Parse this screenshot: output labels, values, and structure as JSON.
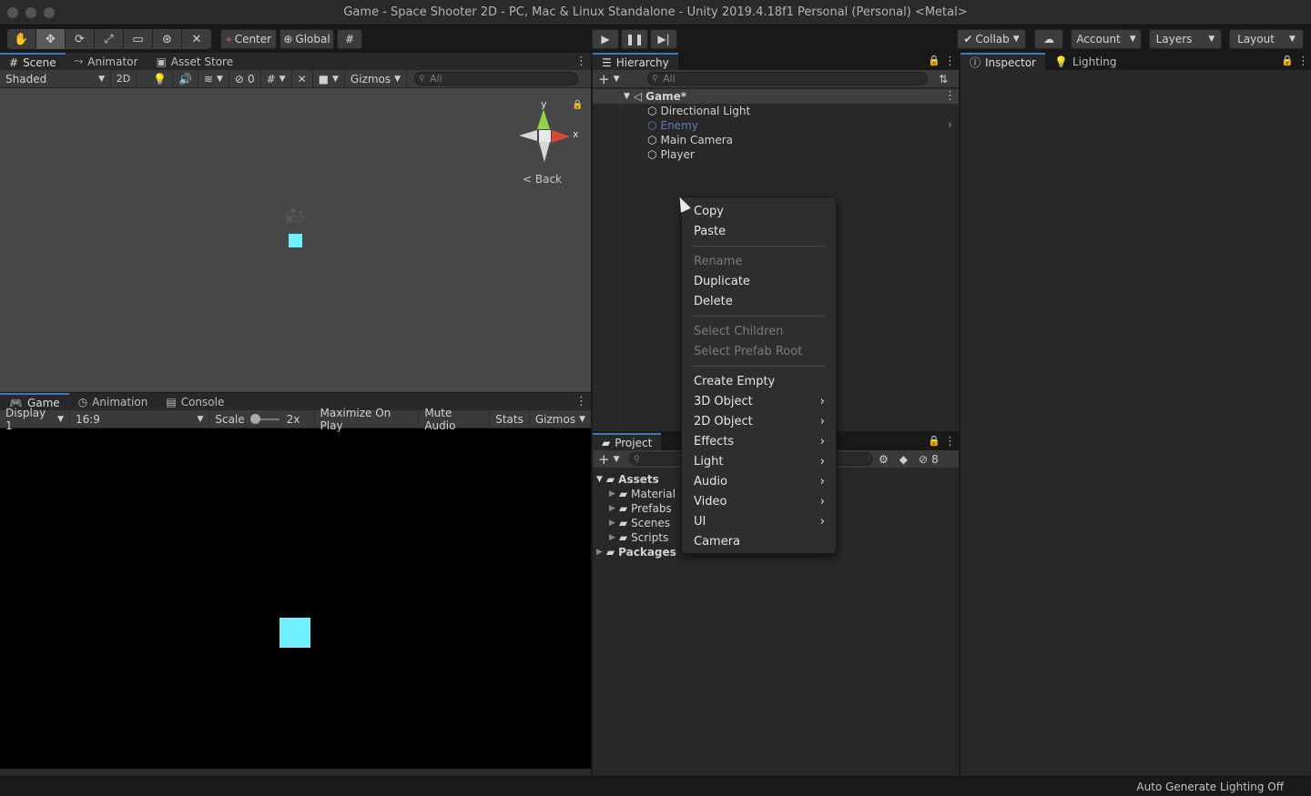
{
  "window": {
    "title": "Game - Space Shooter 2D - PC, Mac & Linux Standalone - Unity 2019.4.18f1 Personal (Personal) <Metal>"
  },
  "toolbar": {
    "center_label": "Center",
    "global_label": "Global",
    "collab_label": "Collab",
    "account_label": "Account",
    "layers_label": "Layers",
    "layout_label": "Layout"
  },
  "scene_panel": {
    "tabs": [
      "Scene",
      "Animator",
      "Asset Store"
    ],
    "shading_mode": "Shaded",
    "mode_2d": "2D",
    "hidden_count": "0",
    "gizmos_label": "Gizmos",
    "search_placeholder": "All",
    "gizmo_y": "y",
    "gizmo_x": "x",
    "back_label": "< Back"
  },
  "game_panel": {
    "tabs": [
      "Game",
      "Animation",
      "Console"
    ],
    "display": "Display 1",
    "aspect": "16:9",
    "scale_label": "Scale",
    "scale_value": "2x",
    "maximize": "Maximize On Play",
    "mute": "Mute Audio",
    "stats": "Stats",
    "gizmos": "Gizmos"
  },
  "hierarchy": {
    "tab": "Hierarchy",
    "search_placeholder": "All",
    "scene_name": "Game*",
    "items": [
      "Directional Light",
      "Enemy",
      "Main Camera",
      "Player"
    ]
  },
  "project": {
    "tab": "Project",
    "hidden_count": "8",
    "root": "Assets",
    "folders": [
      "Material",
      "Prefabs",
      "Scenes",
      "Scripts"
    ],
    "packages": "Packages"
  },
  "inspector": {
    "tabs": [
      "Inspector",
      "Lighting"
    ]
  },
  "context_menu": {
    "copy": "Copy",
    "paste": "Paste",
    "rename": "Rename",
    "duplicate": "Duplicate",
    "delete": "Delete",
    "select_children": "Select Children",
    "select_prefab_root": "Select Prefab Root",
    "create_empty": "Create Empty",
    "object_3d": "3D Object",
    "object_2d": "2D Object",
    "effects": "Effects",
    "light": "Light",
    "audio": "Audio",
    "video": "Video",
    "ui": "UI",
    "camera": "Camera"
  },
  "status": {
    "text": "Auto Generate Lighting Off"
  },
  "colors": {
    "accent": "#3a79bb",
    "cyan_sprite": "#6ff0ff",
    "enemy_text": "#5b7fb5"
  }
}
